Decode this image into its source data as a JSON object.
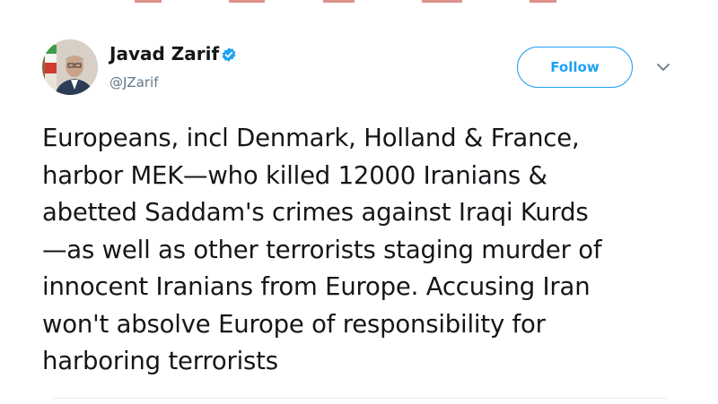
{
  "tweet": {
    "author": {
      "name": "Javad Zarif",
      "handle": "@JZarif",
      "verified": true,
      "avatar_icon": "profile-photo"
    },
    "follow_label": "Follow",
    "menu_icon": "chevron-down-icon",
    "text_lines": [
      "Europeans, incl Denmark, Holland & France,",
      "harbor MEK—who killed 12000 Iranians &",
      "abetted Saddam's crimes against Iraqi Kurds",
      "—as well as other terrorists staging murder of",
      "innocent Iranians from Europe. Accusing Iran",
      "won't absolve Europe of responsibility for",
      "harboring terrorists"
    ]
  },
  "colors": {
    "accent": "#1da1f2",
    "text": "#14171a",
    "secondary_text": "#657786"
  }
}
